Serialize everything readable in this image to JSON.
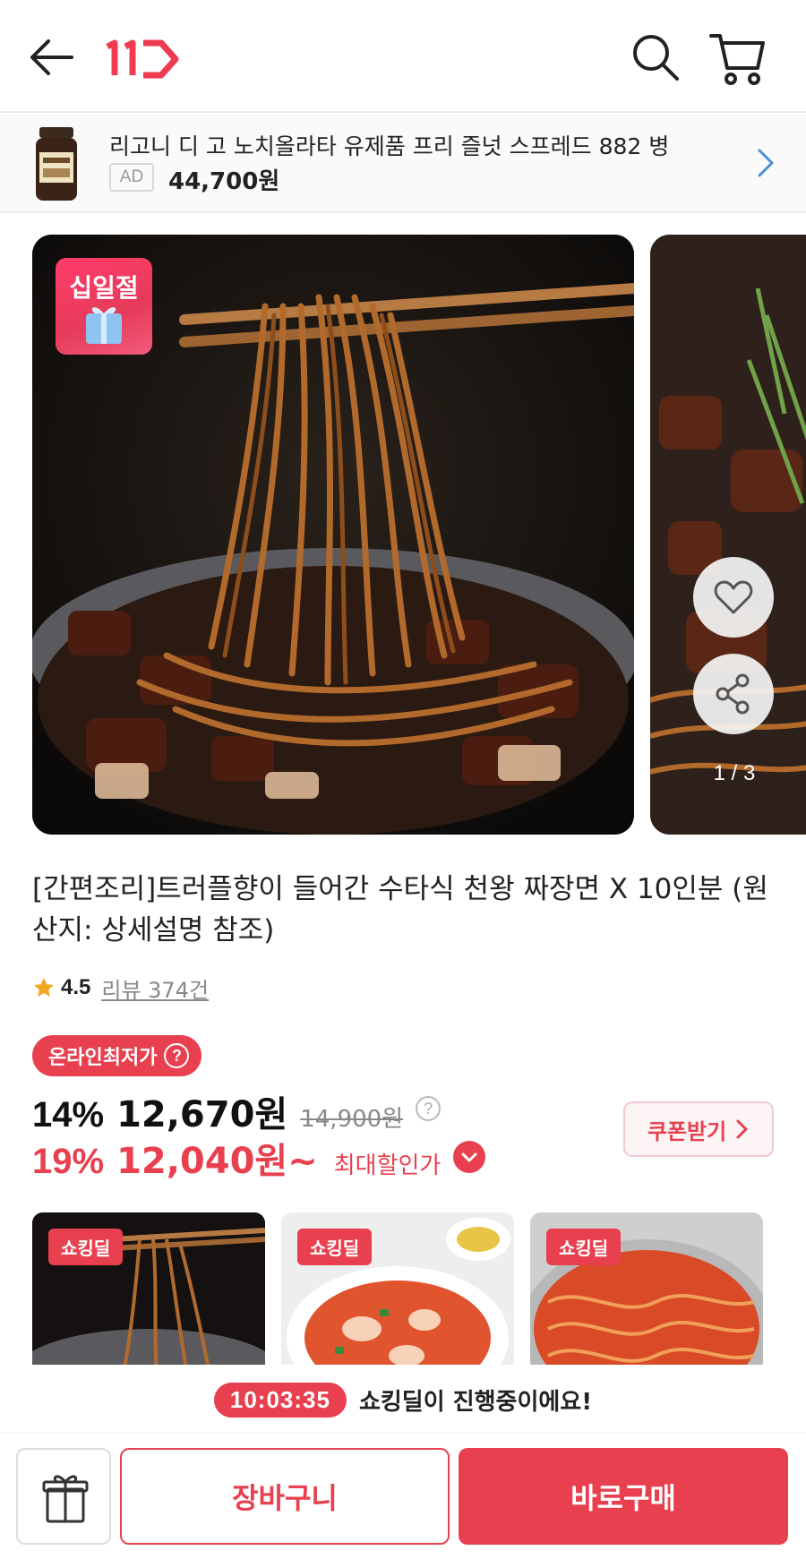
{
  "header": {
    "back_icon": "arrow-left-icon",
    "logo_text": "11",
    "search_icon": "search-icon",
    "cart_icon": "cart-icon"
  },
  "ad": {
    "title": "리고니 디 고 노치올라타 유제품 프리 즐넛 스프레드 882 병",
    "badge": "AD",
    "price": "44,700원"
  },
  "gallery": {
    "event_badge": "십일절",
    "pager": "1 / 3",
    "wish_icon": "heart-icon",
    "share_icon": "share-icon"
  },
  "product": {
    "title": "[간편조리]트러플향이 들어간 수타식 천왕 짜장면 X 10인분 (원산지: 상세설명 참조)",
    "rating": "4.5",
    "reviews": "리뷰 374건"
  },
  "pricing": {
    "lowest_label": "온라인최저가",
    "help": "?",
    "discount1": "14%",
    "price1": "12,670원",
    "original": "14,900원",
    "discount2": "19%",
    "price2": "12,040원~",
    "max_label": "최대할인가",
    "coupon": "쿠폰받기"
  },
  "deals": {
    "tag": "쇼킹딜",
    "items": [
      "쇼킹딜",
      "쇼킹딜",
      "쇼킹딜"
    ]
  },
  "timer": {
    "time": "10:03:35",
    "text": "쇼킹딜이 진행중이에요!"
  },
  "actions": {
    "gift_icon": "gift-icon",
    "cart": "장바구니",
    "buy": "바로구매"
  },
  "colors": {
    "accent": "#e8404f",
    "logo": "#ef3b4f"
  }
}
